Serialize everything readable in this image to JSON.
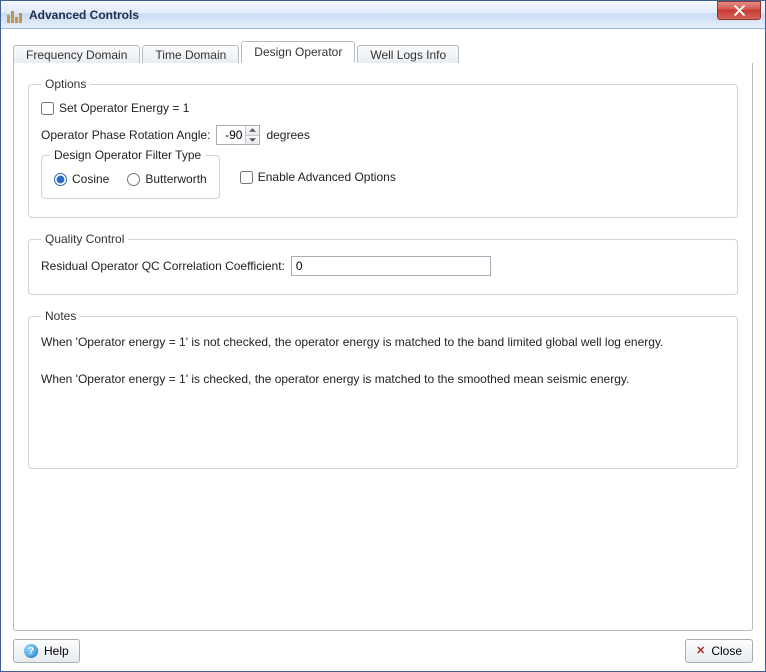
{
  "window": {
    "title": "Advanced Controls"
  },
  "tabs": [
    {
      "label": "Frequency Domain",
      "active": false
    },
    {
      "label": "Time Domain",
      "active": false
    },
    {
      "label": "Design Operator",
      "active": true
    },
    {
      "label": "Well Logs Info",
      "active": false
    }
  ],
  "options": {
    "legend": "Options",
    "set_energy_label": "Set Operator Energy = 1",
    "set_energy_checked": false,
    "phase_label_pre": "Operator Phase Rotation Angle:",
    "phase_value": "-90",
    "phase_label_post": "degrees",
    "filter_group_legend": "Design Operator Filter Type",
    "filter_radios": {
      "cosine": "Cosine",
      "butterworth": "Butterworth",
      "selected": "cosine"
    },
    "enable_advanced_label": "Enable Advanced Options",
    "enable_advanced_checked": false
  },
  "qc": {
    "legend": "Quality Control",
    "label": "Residual Operator QC Correlation Coefficient:",
    "value": "0"
  },
  "notes": {
    "legend": "Notes",
    "p1": "When 'Operator energy = 1' is not checked, the operator energy is matched to the band limited global well log energy.",
    "p2": "When 'Operator energy = 1' is checked, the operator energy is matched to the smoothed mean seismic energy."
  },
  "footer": {
    "help": "Help",
    "close": "Close"
  }
}
